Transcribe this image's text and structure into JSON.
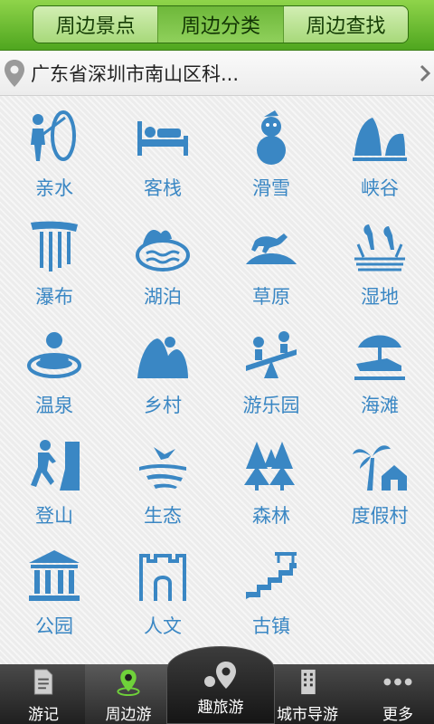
{
  "top_tabs": [
    {
      "label": "周边景点",
      "active": false
    },
    {
      "label": "周边分类",
      "active": true
    },
    {
      "label": "周边查找",
      "active": false
    }
  ],
  "location": {
    "text": "广东省深圳市南山区科..."
  },
  "categories": [
    {
      "label": "亲水",
      "icon": "water-sports-icon"
    },
    {
      "label": "客栈",
      "icon": "inn-bed-icon"
    },
    {
      "label": "滑雪",
      "icon": "snowman-icon"
    },
    {
      "label": "峡谷",
      "icon": "canyon-icon"
    },
    {
      "label": "瀑布",
      "icon": "waterfall-icon"
    },
    {
      "label": "湖泊",
      "icon": "lake-icon"
    },
    {
      "label": "草原",
      "icon": "grassland-horse-icon"
    },
    {
      "label": "湿地",
      "icon": "wetland-bird-icon"
    },
    {
      "label": "温泉",
      "icon": "hot-spring-icon"
    },
    {
      "label": "乡村",
      "icon": "village-icon"
    },
    {
      "label": "游乐园",
      "icon": "seesaw-icon"
    },
    {
      "label": "海滩",
      "icon": "beach-umbrella-icon"
    },
    {
      "label": "登山",
      "icon": "climber-icon"
    },
    {
      "label": "生态",
      "icon": "ecology-bird-icon"
    },
    {
      "label": "森林",
      "icon": "forest-icon"
    },
    {
      "label": "度假村",
      "icon": "resort-palm-icon"
    },
    {
      "label": "公园",
      "icon": "park-temple-icon"
    },
    {
      "label": "人文",
      "icon": "great-wall-icon"
    },
    {
      "label": "古镇",
      "icon": "ancient-stairs-icon"
    }
  ],
  "bottom_nav": [
    {
      "label": "游记",
      "icon": "document-icon",
      "active": false
    },
    {
      "label": "周边游",
      "icon": "location-pin-icon",
      "active": true
    },
    {
      "label": "趣旅游",
      "icon": "fun-travel-icon",
      "active": false
    },
    {
      "label": "城市导游",
      "icon": "city-building-icon",
      "active": false
    },
    {
      "label": "更多",
      "icon": "more-dots-icon",
      "active": false
    }
  ],
  "colors": {
    "accent_green": "#5aaa2a",
    "category_blue": "#3a87c4",
    "nav_bg": "#2a2a2a"
  }
}
